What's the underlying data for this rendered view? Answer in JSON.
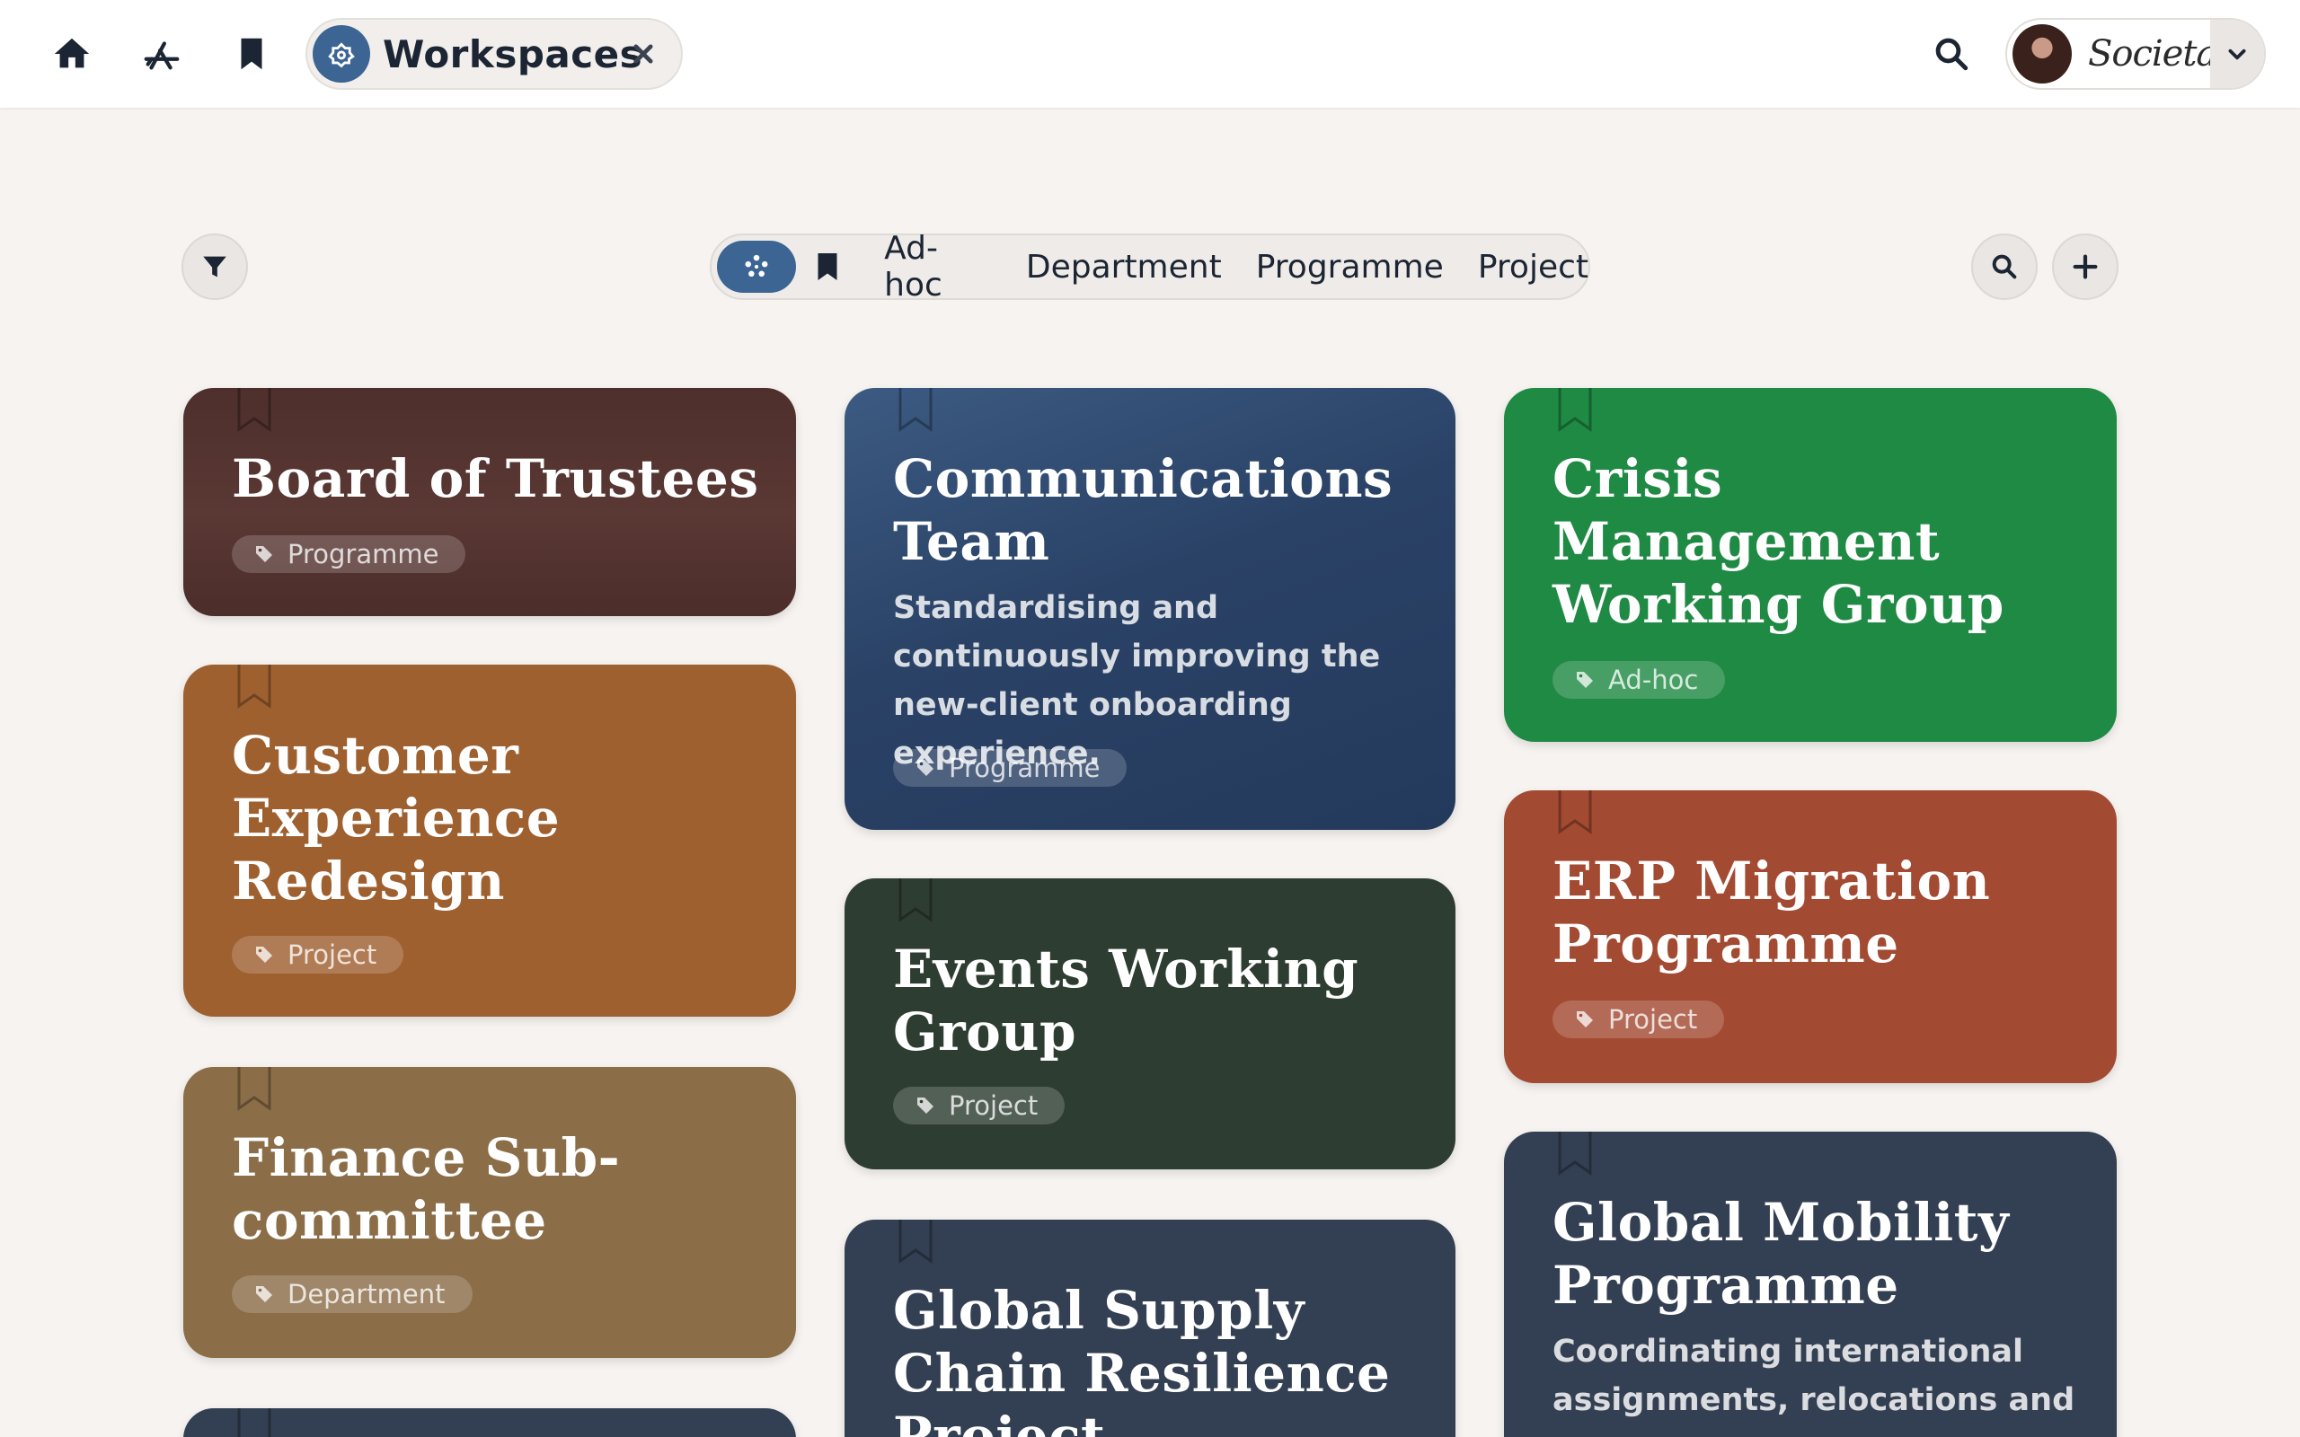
{
  "topbar": {
    "workspace_pill_label": "Workspaces",
    "org_logo_text": "Societas"
  },
  "filters": {
    "segments": [
      "Ad-hoc",
      "Department",
      "Programme",
      "Project"
    ]
  },
  "colors": {
    "accent": "#3c6594",
    "background": "#f6f3f0",
    "card_board": "#4e2f2c",
    "card_comms": "#2a4266",
    "card_crisis": "#1f8a44",
    "card_customer": "#9f6030",
    "card_events": "#2e3d31",
    "card_erp": "#a34a32",
    "card_finance": "#8b6d48",
    "card_supply": "#333f52",
    "card_mobility": "#333f52"
  },
  "cards": [
    {
      "title": "Board of Trustees",
      "tag": "Programme"
    },
    {
      "title": "Customer Experience Redesign",
      "tag": "Project"
    },
    {
      "title": "Finance Sub-committee",
      "tag": "Department"
    },
    {
      "title": "Communications Team",
      "description": "Standardising and continuously improving the new-client onboarding experience.",
      "tag": "Programme"
    },
    {
      "title": "Events Working Group",
      "tag": "Project"
    },
    {
      "title": "Global Supply Chain Resilience Project"
    },
    {
      "title": "Crisis Management Working Group",
      "tag": "Ad-hoc"
    },
    {
      "title": "ERP Migration Programme",
      "tag": "Project"
    },
    {
      "title": "Global Mobility Programme",
      "description": "Coordinating international assignments, relocations and"
    }
  ]
}
